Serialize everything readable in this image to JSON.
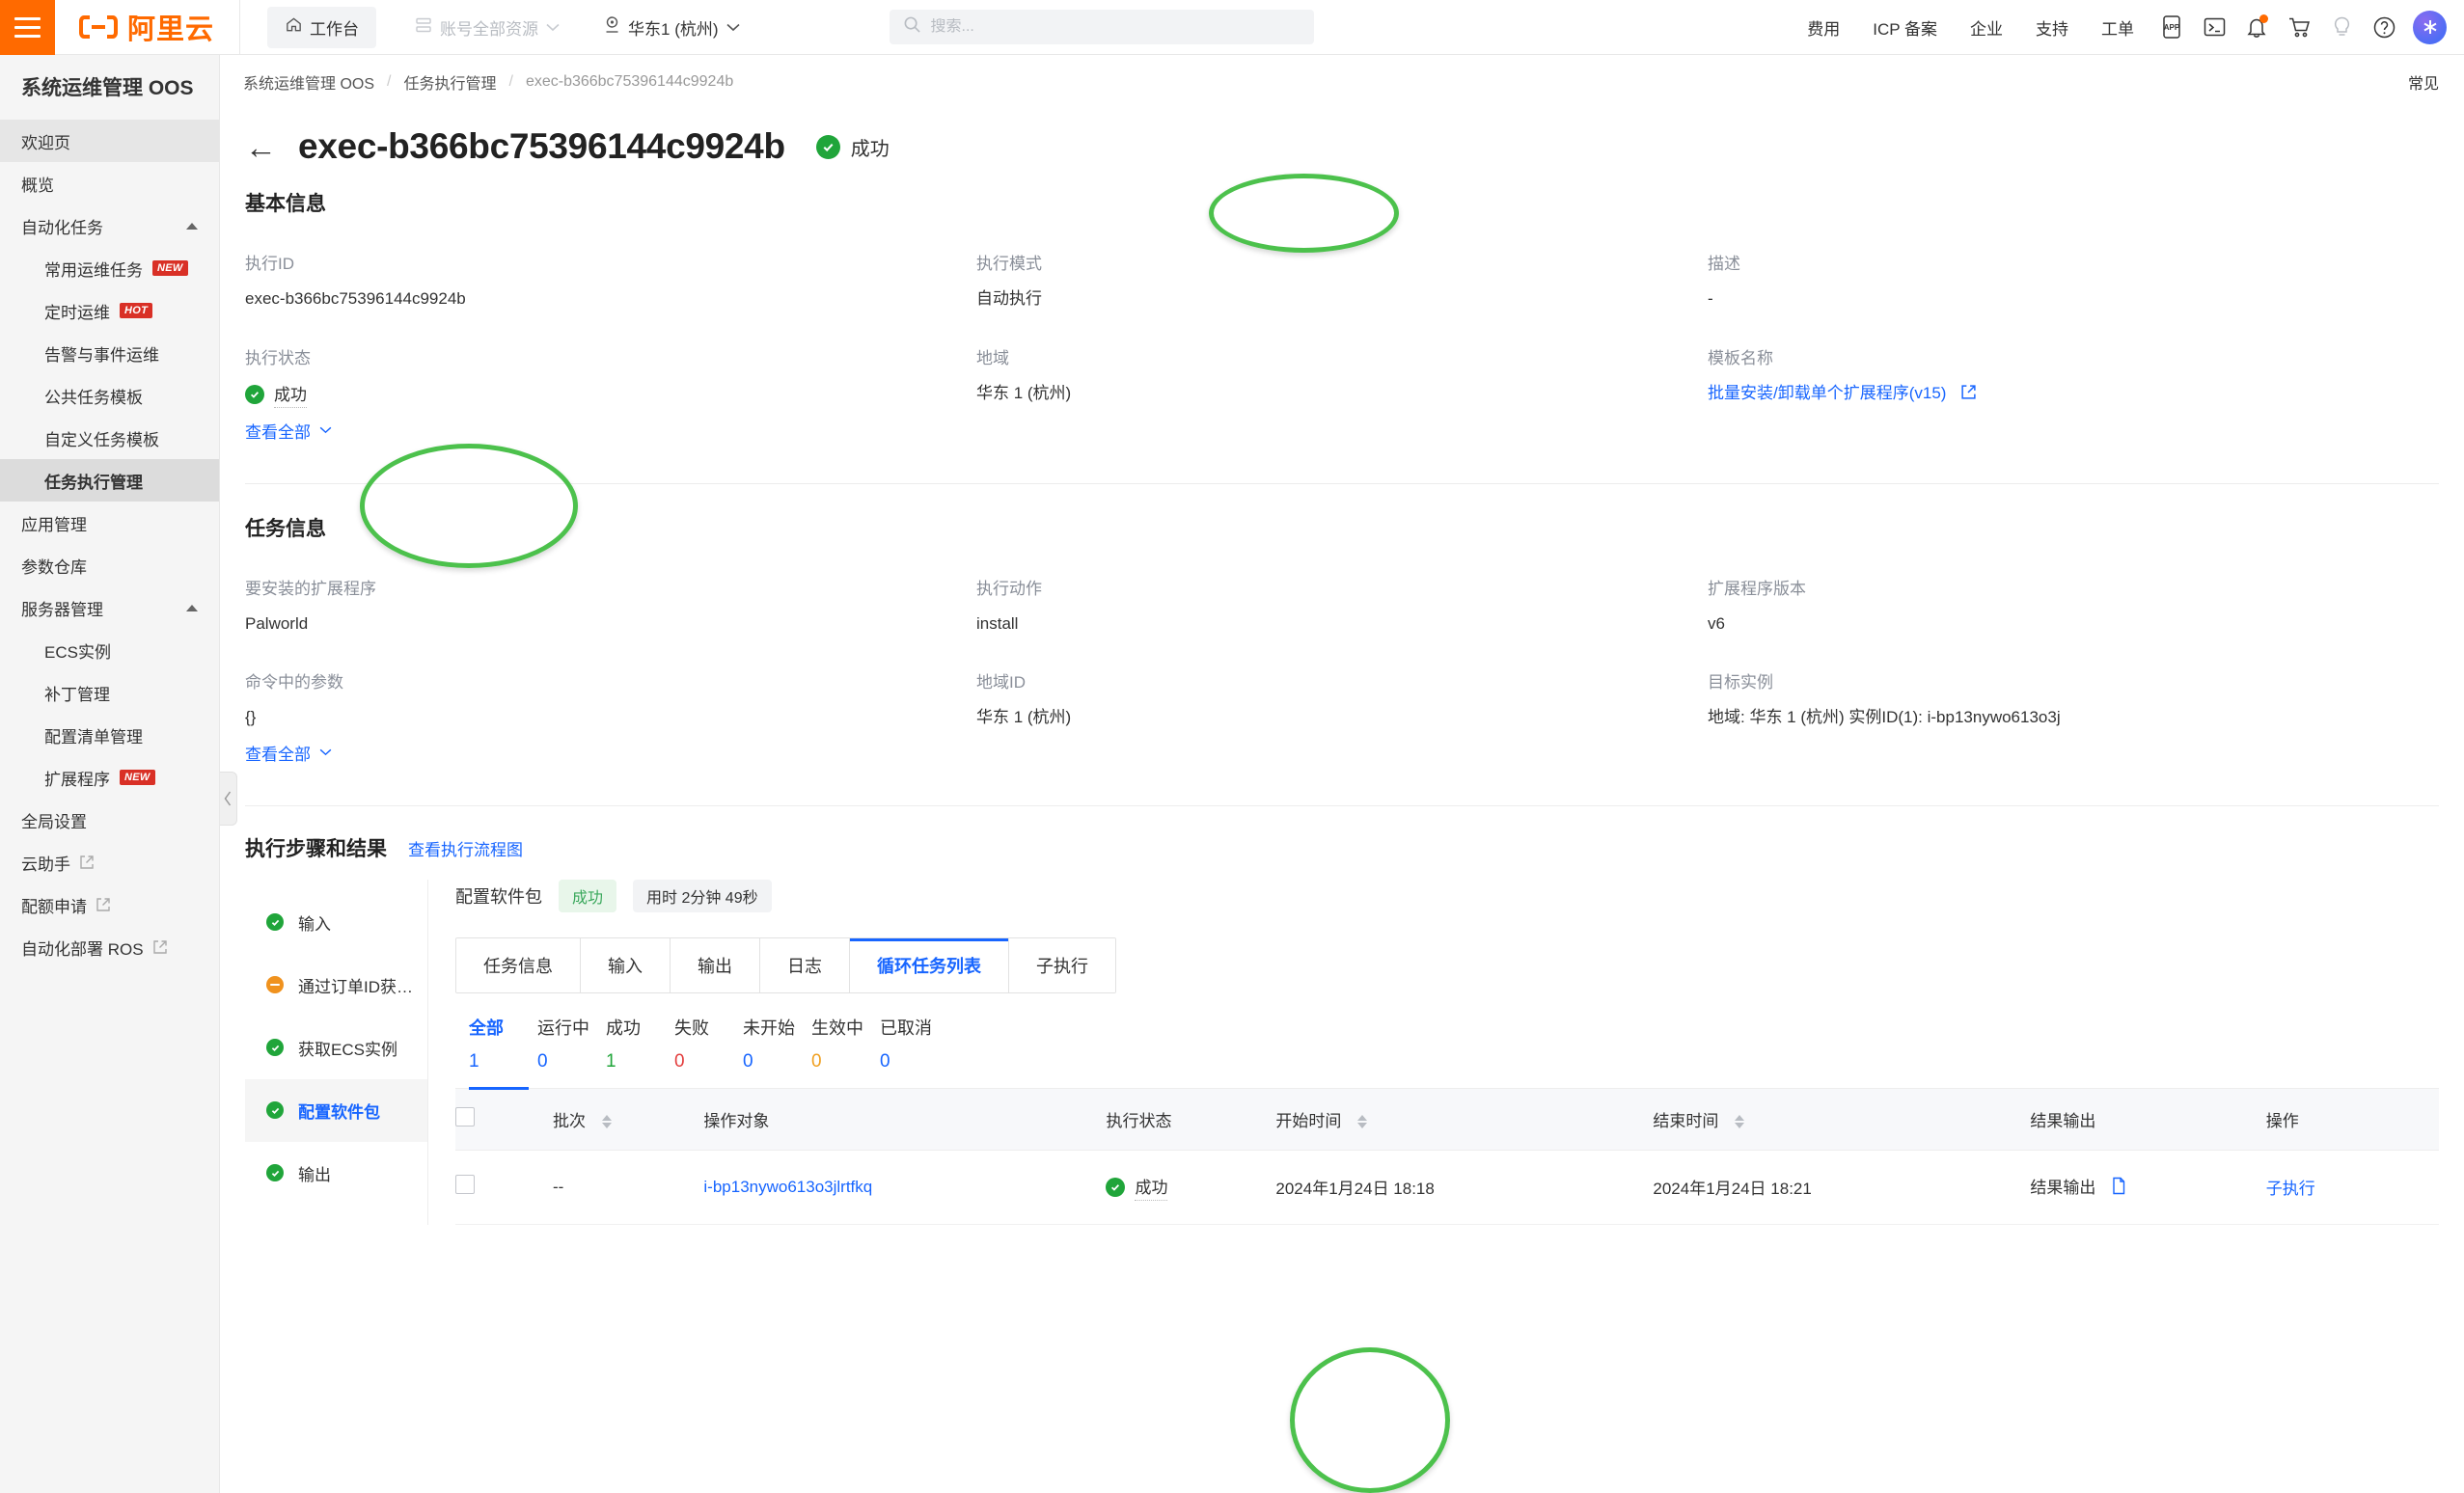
{
  "header": {
    "logo_text": "阿里云",
    "workbench": "工作台",
    "all_resources": "账号全部资源",
    "region": "华东1 (杭州)",
    "search_placeholder": "搜索...",
    "search_value": "",
    "nav_links": [
      "费用",
      "ICP 备案",
      "企业",
      "支持",
      "工单"
    ],
    "icons": [
      "app-icon",
      "terminal-icon",
      "bell-icon",
      "cart-icon",
      "lightbulb-icon",
      "help-icon",
      "avatar"
    ]
  },
  "sidebar": {
    "title": "系统运维管理 OOS",
    "items": [
      {
        "label": "欢迎页",
        "level": 0,
        "active": false,
        "highlight": true
      },
      {
        "label": "概览",
        "level": 0,
        "active": false
      },
      {
        "label": "自动化任务",
        "level": 0,
        "collapsible": true
      },
      {
        "label": "常用运维任务",
        "level": 1,
        "tag": "NEW"
      },
      {
        "label": "定时运维",
        "level": 1,
        "tag": "HOT"
      },
      {
        "label": "告警与事件运维",
        "level": 1
      },
      {
        "label": "公共任务模板",
        "level": 1
      },
      {
        "label": "自定义任务模板",
        "level": 1
      },
      {
        "label": "任务执行管理",
        "level": 1,
        "active": true
      },
      {
        "label": "应用管理",
        "level": 0
      },
      {
        "label": "参数仓库",
        "level": 0
      },
      {
        "label": "服务器管理",
        "level": 0,
        "collapsible": true
      },
      {
        "label": "ECS实例",
        "level": 1
      },
      {
        "label": "补丁管理",
        "level": 1
      },
      {
        "label": "配置清单管理",
        "level": 1
      },
      {
        "label": "扩展程序",
        "level": 1,
        "tag": "NEW"
      },
      {
        "label": "全局设置",
        "level": 0
      },
      {
        "label": "云助手",
        "level": 0,
        "external": true
      },
      {
        "label": "配额申请",
        "level": 0,
        "external": true
      },
      {
        "label": "自动化部署 ROS",
        "level": 0,
        "external": true
      }
    ]
  },
  "breadcrumb": {
    "items": [
      "系统运维管理 OOS",
      "任务执行管理",
      "exec-b366bc75396144c9924b"
    ],
    "separator": "/",
    "faq": "常见"
  },
  "page": {
    "title": "exec-b366bc75396144c9924b",
    "status_text": "成功"
  },
  "basic_info": {
    "heading": "基本信息",
    "fields": [
      {
        "label": "执行ID",
        "value": "exec-b366bc75396144c9924b"
      },
      {
        "label": "执行模式",
        "value": "自动执行"
      },
      {
        "label": "描述",
        "value": "-"
      },
      {
        "label": "执行状态",
        "value": "成功",
        "type": "status",
        "view_all": "查看全部"
      },
      {
        "label": "地域",
        "value": "华东 1 (杭州)"
      },
      {
        "label": "模板名称",
        "value": "批量安装/卸载单个扩展程序(v15)",
        "type": "link-external"
      }
    ]
  },
  "task_info": {
    "heading": "任务信息",
    "fields": [
      {
        "label": "要安装的扩展程序",
        "value": "Palworld"
      },
      {
        "label": "执行动作",
        "value": "install"
      },
      {
        "label": "扩展程序版本",
        "value": "v6"
      },
      {
        "label": "命令中的参数",
        "value": "{}",
        "view_all": "查看全部"
      },
      {
        "label": "地域ID",
        "value": "华东 1 (杭州)"
      },
      {
        "label": "目标实例",
        "value": "地域: 华东 1 (杭州) 实例ID(1): i-bp13nywo613o3j"
      }
    ]
  },
  "exec_steps": {
    "heading": "执行步骤和结果",
    "flow_link": "查看执行流程图",
    "steps": [
      {
        "label": "输入",
        "status": "success"
      },
      {
        "label": "通过订单ID获取E...",
        "status": "skipped"
      },
      {
        "label": "获取ECS实例",
        "status": "success"
      },
      {
        "label": "配置软件包",
        "status": "success",
        "active": true
      },
      {
        "label": "输出",
        "status": "success"
      }
    ],
    "panel": {
      "title": "配置软件包",
      "status_pill": "成功",
      "duration_pill": "用时 2分钟 49秒",
      "tabs": [
        {
          "label": "任务信息",
          "active": false
        },
        {
          "label": "输入",
          "active": false
        },
        {
          "label": "输出",
          "active": false
        },
        {
          "label": "日志",
          "active": false
        },
        {
          "label": "循环任务列表",
          "active": true
        },
        {
          "label": "子执行",
          "active": false
        }
      ],
      "stats": [
        {
          "label": "全部",
          "count": "1",
          "color": "#1765ff",
          "active": true
        },
        {
          "label": "运行中",
          "count": "0",
          "color": "#1765ff"
        },
        {
          "label": "成功",
          "count": "1",
          "color": "#20a53a"
        },
        {
          "label": "失败",
          "count": "0",
          "color": "#e33d3d"
        },
        {
          "label": "未开始",
          "count": "0",
          "color": "#1765ff"
        },
        {
          "label": "生效中",
          "count": "0",
          "color": "#f0a020"
        },
        {
          "label": "已取消",
          "count": "0",
          "color": "#1765ff"
        }
      ],
      "table": {
        "columns": [
          "批次",
          "操作对象",
          "执行状态",
          "开始时间",
          "结束时间",
          "结果输出",
          "操作"
        ],
        "rows": [
          {
            "batch": "--",
            "target": "i-bp13nywo613o3jlrtfkq",
            "status": "成功",
            "start_time": "2024年1月24日 18:18",
            "end_time": "2024年1月24日 18:21",
            "result_output": "结果输出",
            "action": "子执行"
          }
        ]
      }
    }
  },
  "colors": {
    "brand_orange": "#ff6a00",
    "link_blue": "#1765ff",
    "success_green": "#20a53a",
    "annotation_green": "#4cc14c",
    "error_red": "#e33d3d",
    "warn_orange": "#f0921e"
  }
}
